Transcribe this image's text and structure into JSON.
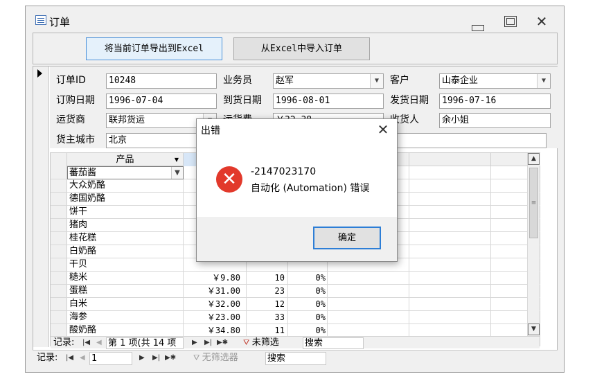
{
  "window": {
    "title": "订单"
  },
  "header": {
    "export_label": "将当前订单导出到Excel",
    "import_label": "从Excel中导入订单"
  },
  "fields": {
    "order_id": {
      "label": "订单ID",
      "value": "10248"
    },
    "salesperson": {
      "label": "业务员",
      "value": "赵军"
    },
    "customer": {
      "label": "客户",
      "value": "山泰企业"
    },
    "order_date": {
      "label": "订购日期",
      "value": "1996-07-04"
    },
    "arrival_date": {
      "label": "到货日期",
      "value": "1996-08-01"
    },
    "ship_date": {
      "label": "发货日期",
      "value": "1996-07-16"
    },
    "shipper": {
      "label": "运货商",
      "value": "联邦货运"
    },
    "freight": {
      "label": "运货费",
      "value": "￥32.38"
    },
    "recipient": {
      "label": "收货人",
      "value": "余小姐"
    },
    "city": {
      "label": "货主城市",
      "value": "北京"
    }
  },
  "subform": {
    "columns": {
      "product": "产品"
    },
    "rows": [
      {
        "name": "蕃茄酱",
        "price": "",
        "qty": "",
        "disc": ""
      },
      {
        "name": "大众奶酪",
        "price": "",
        "qty": "",
        "disc": ""
      },
      {
        "name": "德国奶酪",
        "price": "",
        "qty": "",
        "disc": ""
      },
      {
        "name": "饼干",
        "price": "",
        "qty": "",
        "disc": ""
      },
      {
        "name": "猪肉",
        "price": "",
        "qty": "",
        "disc": ""
      },
      {
        "name": "桂花糕",
        "price": "",
        "qty": "",
        "disc": ""
      },
      {
        "name": "白奶酪",
        "price": "",
        "qty": "",
        "disc": ""
      },
      {
        "name": "干贝",
        "price": "",
        "qty": "",
        "disc": ""
      },
      {
        "name": "糙米",
        "price": "￥9.80",
        "qty": "10",
        "disc": "0%"
      },
      {
        "name": "蛋糕",
        "price": "￥31.00",
        "qty": "23",
        "disc": "0%"
      },
      {
        "name": "白米",
        "price": "￥32.00",
        "qty": "12",
        "disc": "0%"
      },
      {
        "name": "海参",
        "price": "￥23.00",
        "qty": "33",
        "disc": "0%"
      },
      {
        "name": "酸奶酪",
        "price": "￥34.80",
        "qty": "11",
        "disc": "0%"
      }
    ],
    "nav": {
      "record_label": "记录:",
      "position": "第 1 项(共 14 项",
      "filter": "未筛选",
      "search": "搜索"
    }
  },
  "main_nav": {
    "record_label": "记录:",
    "position": "1",
    "filter": "无筛选器",
    "search": "搜索"
  },
  "dialog": {
    "title": "出错",
    "code": "-2147023170",
    "message": "自动化 (Automation) 错误",
    "ok_label": "确定"
  },
  "colors": {
    "error_red": "#e2392b",
    "focus_blue": "#2d7ed6"
  }
}
